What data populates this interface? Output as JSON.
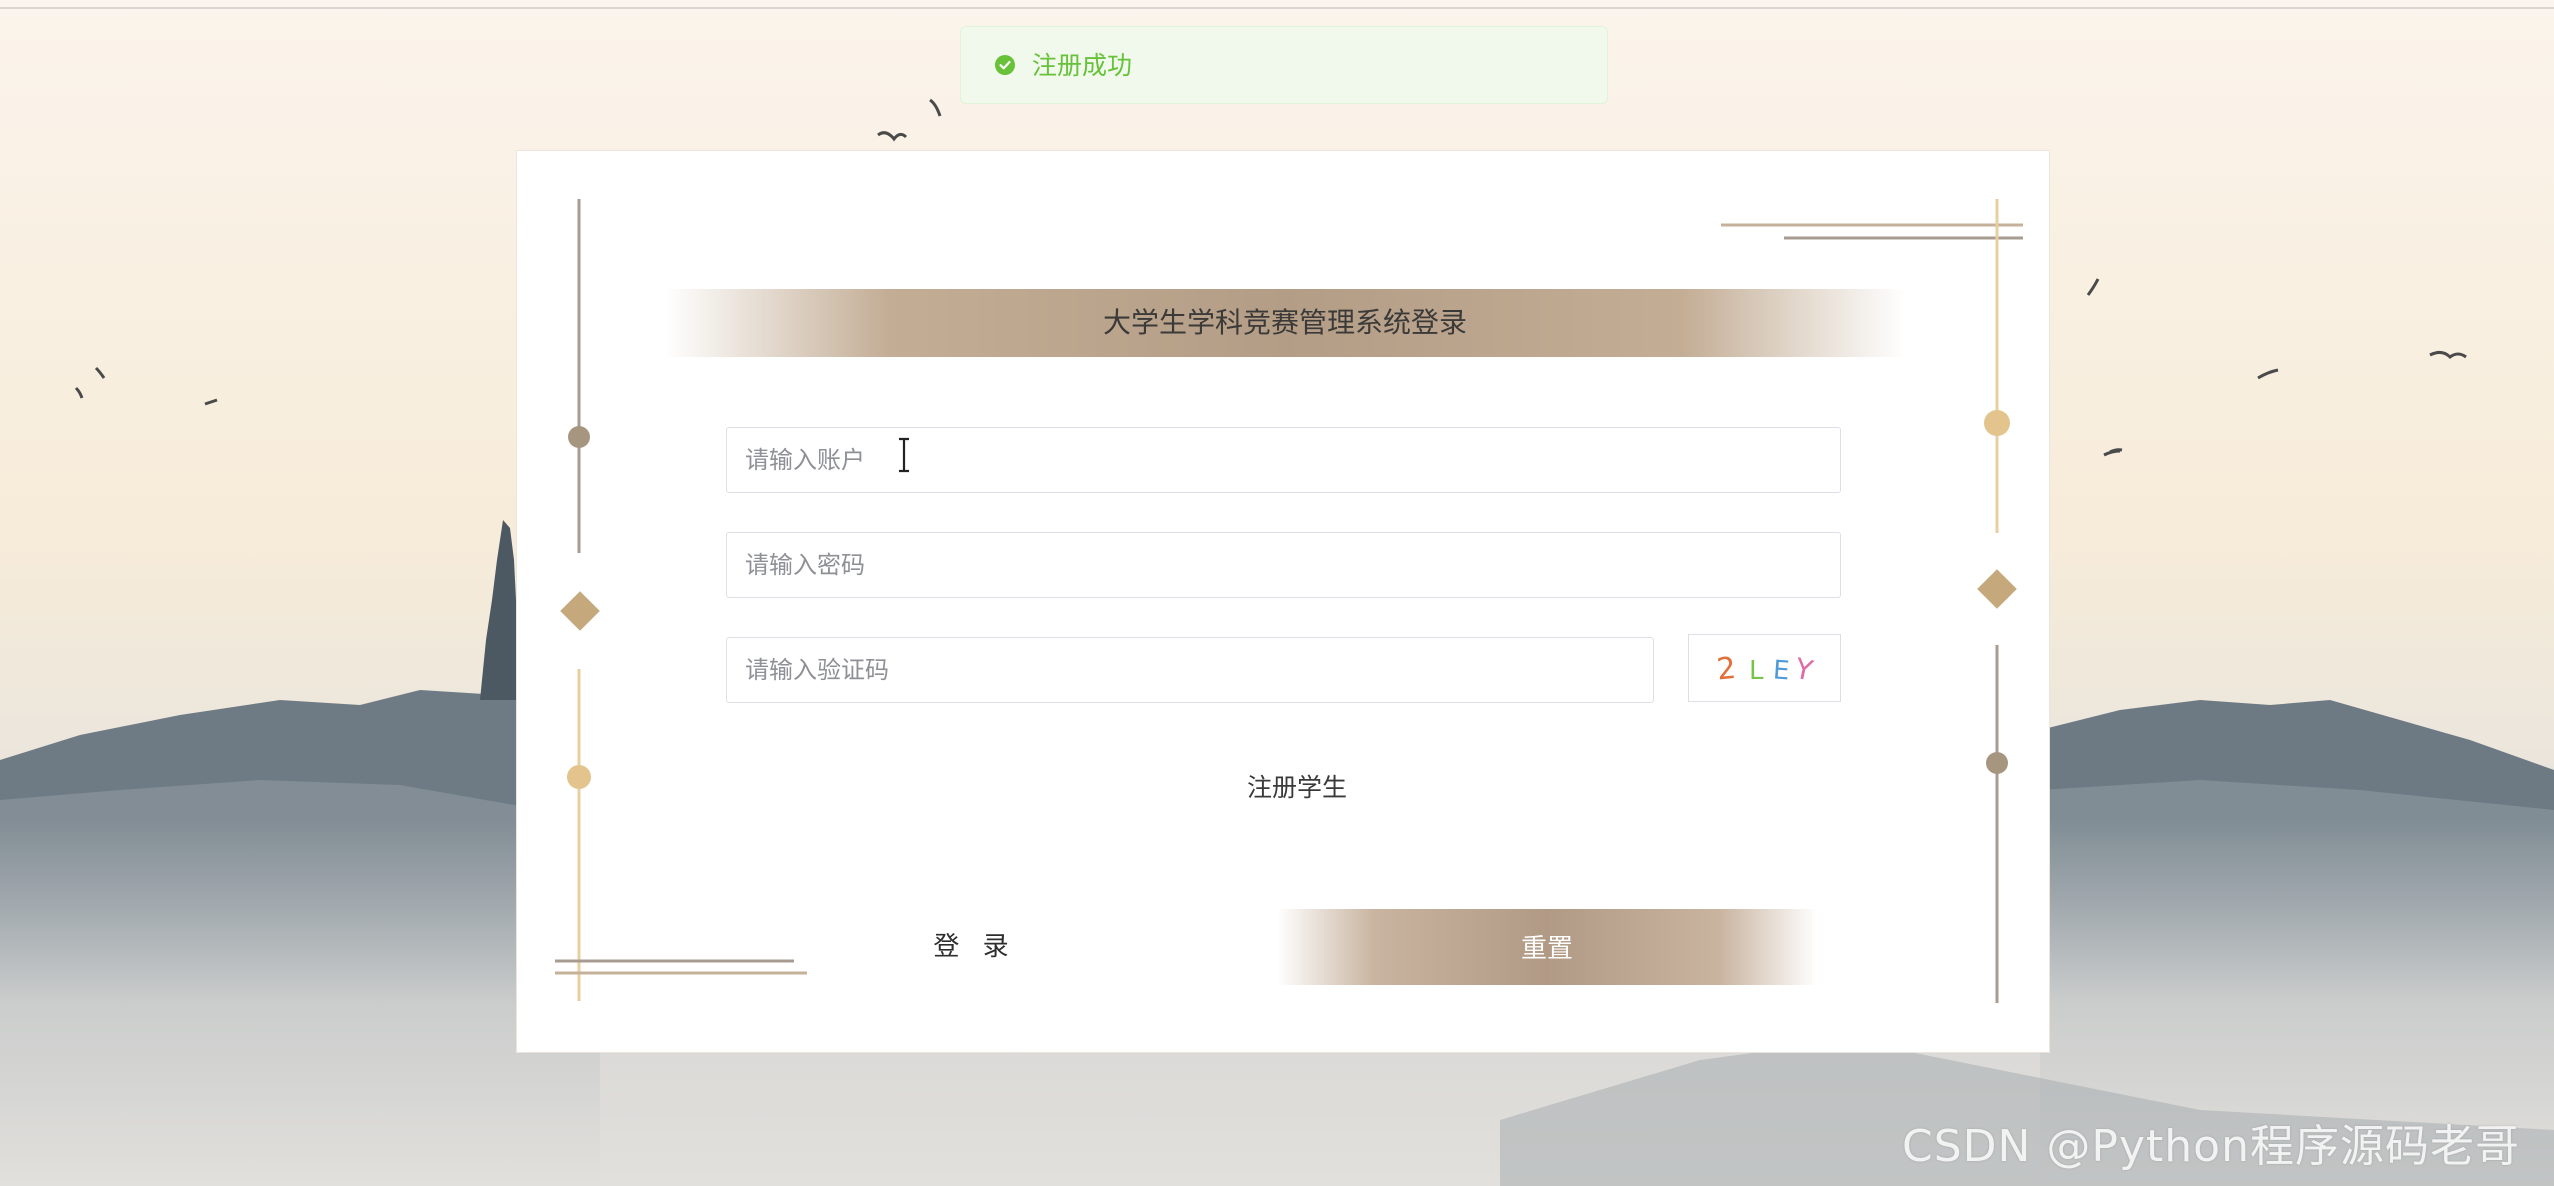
{
  "toast": {
    "message": "注册成功",
    "icon": "check-circle-icon",
    "color": "#67c23a"
  },
  "login": {
    "title": "大学生学科竞赛管理系统登录",
    "account_placeholder": "请输入账户",
    "password_placeholder": "请输入密码",
    "captcha_placeholder": "请输入验证码",
    "captcha_text": "2LEY",
    "register_link": "注册学生",
    "login_button": "登 录",
    "reset_button": "重置"
  },
  "watermark": "CSDN @Python程序源码老哥",
  "colors": {
    "accent": "#b39d86",
    "gold": "#e2c48c",
    "diamond": "#c5a97c"
  }
}
